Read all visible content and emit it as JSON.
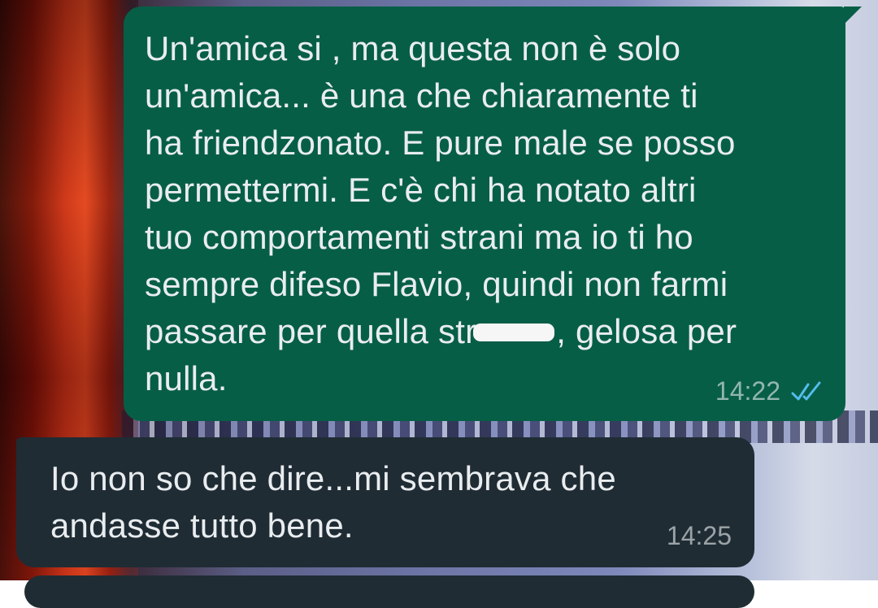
{
  "messages": [
    {
      "direction": "outgoing",
      "text_before_redaction": "Un'amica si , ma questa non è solo\nun'amica... è una che chiaramente ti\nha friendzonato. E pure male se posso\npermettermi. E c'è chi ha notato altri\ntuo comportamenti strani ma io ti ho\nsempre difeso Flavio, quindi non farmi\npassare per quella str",
      "text_after_redaction": ", gelosa per\nnulla.",
      "time": "14:22",
      "status_icon": "double-check-read-icon"
    },
    {
      "direction": "incoming",
      "text": "Io non so che dire...mi sembrava che\nandasse tutto bene.",
      "time": "14:25"
    }
  ],
  "colors": {
    "outgoing_bubble": "#075e46",
    "incoming_bubble": "#1f2c34",
    "message_text": "#e9edef",
    "read_tick": "#53bdeb"
  }
}
